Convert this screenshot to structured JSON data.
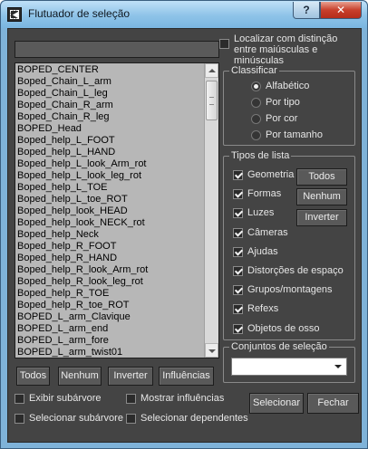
{
  "window": {
    "title": "Flutuador de seleção",
    "help_label": "?",
    "close_label": "✕"
  },
  "search": {
    "value": "",
    "case_sensitive_label": "Localizar com distinção entre maiúsculas e minúsculas",
    "case_sensitive_checked": false
  },
  "objects": [
    "BOPED_CENTER",
    "Boped_Chain_L_arm",
    "Boped_Chain_L_leg",
    "Boped_Chain_R_arm",
    "Boped_Chain_R_leg",
    "BOPED_Head",
    "Boped_help_L_FOOT",
    "Boped_help_L_HAND",
    "Boped_help_L_look_Arm_rot",
    "Boped_help_L_look_leg_rot",
    "Boped_help_L_TOE",
    "Boped_help_L_toe_ROT",
    "Boped_help_look_HEAD",
    "Boped_help_look_NECK_rot",
    "Boped_help_Neck",
    "Boped_help_R_FOOT",
    "Boped_help_R_HAND",
    "Boped_help_R_look_Arm_rot",
    "Boped_help_R_look_leg_rot",
    "Boped_help_R_TOE",
    "Boped_help_R_toe_ROT",
    "BOPED_L_arm_Clavique",
    "BOPED_L_arm_end",
    "BOPED_L_arm_fore",
    "BOPED_L_arm_twist01"
  ],
  "list_buttons": {
    "all": "Todos",
    "none": "Nenhum",
    "invert": "Inverter",
    "influences": "Influências"
  },
  "options": {
    "show_subtree": "Exibir subárvore",
    "show_subtree_checked": false,
    "select_subtree": "Selecionar subárvore",
    "select_subtree_checked": false,
    "show_influences": "Mostrar influências",
    "show_influences_checked": false,
    "select_dependents": "Selecionar dependentes",
    "select_dependents_checked": false
  },
  "sort": {
    "title": "Classificar",
    "options": [
      "Alfabético",
      "Por tipo",
      "Por cor",
      "Por tamanho"
    ],
    "selected": "Alfabético"
  },
  "list_types": {
    "title": "Tipos de lista",
    "items": [
      {
        "label": "Geometria",
        "checked": true
      },
      {
        "label": "Formas",
        "checked": true
      },
      {
        "label": "Luzes",
        "checked": true
      },
      {
        "label": "Câmeras",
        "checked": true
      },
      {
        "label": "Ajudas",
        "checked": true
      },
      {
        "label": "Distorções de espaço",
        "checked": true
      },
      {
        "label": "Grupos/montagens",
        "checked": true
      },
      {
        "label": "Refexs",
        "checked": true
      },
      {
        "label": "Objetos de osso",
        "checked": true
      }
    ],
    "buttons": {
      "all": "Todos",
      "none": "Nenhum",
      "invert": "Inverter"
    }
  },
  "selection_sets": {
    "title": "Conjuntos de seleção",
    "selected": ""
  },
  "actions": {
    "select": "Selecionar",
    "close": "Fechar"
  }
}
